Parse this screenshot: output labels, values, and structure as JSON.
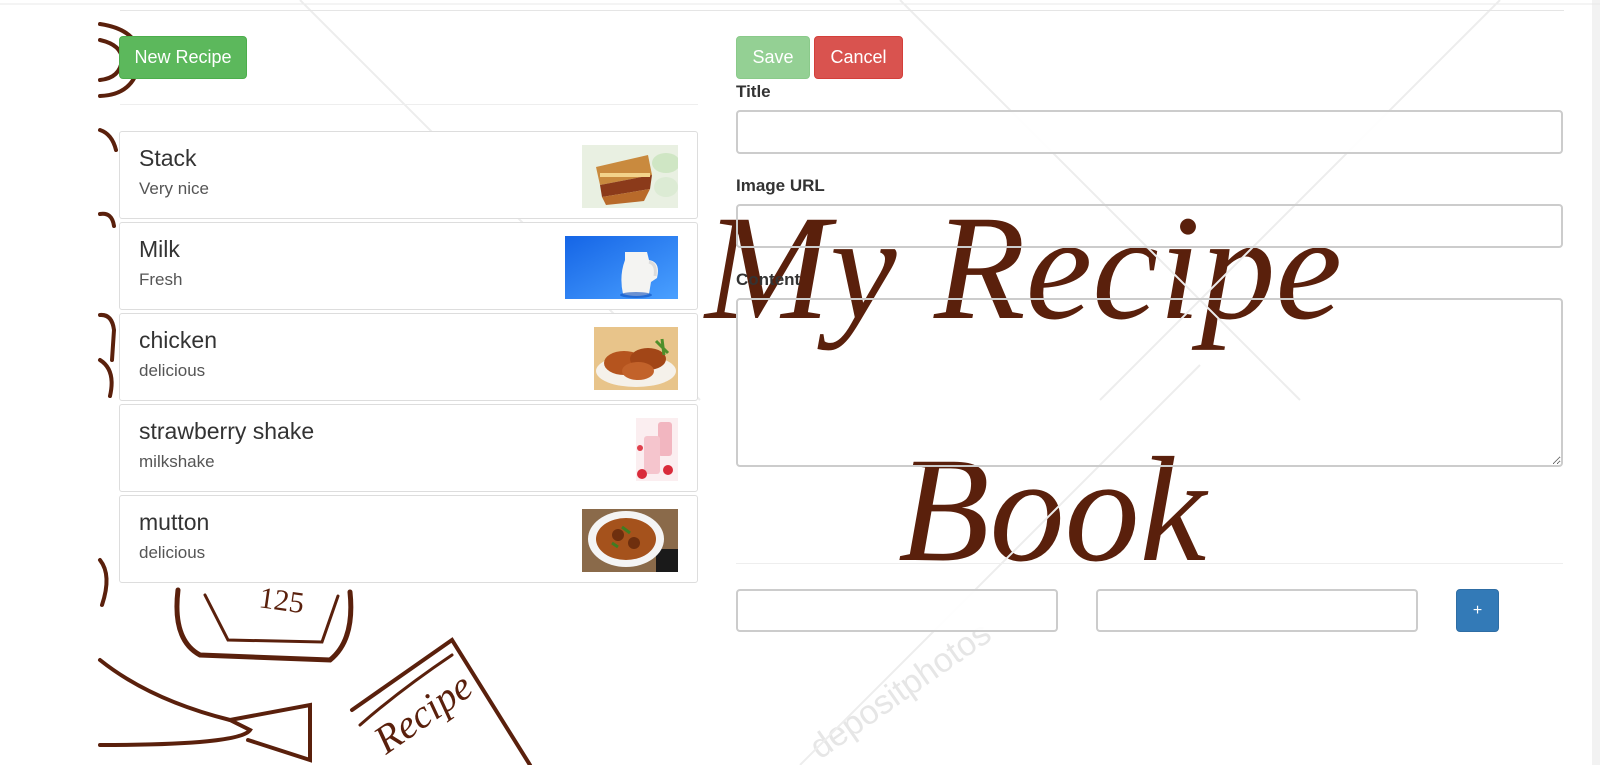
{
  "toolbar": {
    "new_recipe_label": "New Recipe",
    "save_label": "Save",
    "cancel_label": "Cancel"
  },
  "recipes": [
    {
      "title": "Stack",
      "description": "Very nice",
      "thumbnail": "lasagna-image"
    },
    {
      "title": "Milk",
      "description": "Fresh",
      "thumbnail": "milk-jug-image"
    },
    {
      "title": "chicken",
      "description": "delicious",
      "thumbnail": "roast-chicken-image"
    },
    {
      "title": "strawberry shake",
      "description": "milkshake",
      "thumbnail": "strawberry-shake-image"
    },
    {
      "title": "mutton",
      "description": "delicious",
      "thumbnail": "mutton-curry-image"
    }
  ],
  "form": {
    "title_label": "Title",
    "title_value": "",
    "image_url_label": "Image URL",
    "image_url_value": "",
    "content_label": "Content",
    "content_value": "",
    "ingredient_name_value": "",
    "ingredient_amount_value": "",
    "add_ingredient_label": "+"
  },
  "background": {
    "banner_line1": "My Recipe",
    "banner_line2": "Book",
    "card_text": "Recipe",
    "timer_text": "125",
    "watermark": "depositphotos"
  },
  "colors": {
    "success": "#5cb85c",
    "danger": "#d9534f",
    "primary": "#337ab7",
    "art": "#5a200c"
  }
}
